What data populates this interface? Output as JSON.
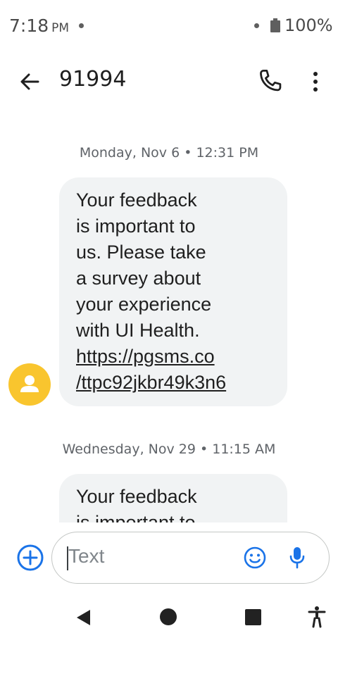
{
  "status_bar": {
    "time": "7:18",
    "ampm": "PM",
    "battery": "100%"
  },
  "header": {
    "title": "91994",
    "icons": [
      "back-arrow-icon",
      "phone-icon",
      "more-vert-icon"
    ]
  },
  "conversation": {
    "messages": [
      {
        "date": "Monday, Nov 6 • 12:31 PM",
        "lines": [
          "Your feedback",
          "is important to",
          "us. Please take",
          "a survey about",
          "your experience",
          "with UI Health."
        ],
        "link_lines": [
          "https://pgsms.co",
          "/ttpc92jkbr49k3n6"
        ]
      },
      {
        "date": "Wednesday, Nov 29 • 11:15 AM",
        "lines": [
          "Your feedback",
          "is important to"
        ]
      }
    ],
    "avatar_color": "#F9C52E",
    "bubble_color": "#F1F3F4"
  },
  "compose": {
    "placeholder": "Text",
    "accent_color": "#1A73E8",
    "icons": [
      "add-circle-icon",
      "emoji-icon",
      "mic-icon"
    ]
  },
  "nav_bar": {
    "icons": [
      "nav-back-icon",
      "nav-home-icon",
      "nav-recents-icon",
      "accessibility-icon"
    ]
  }
}
